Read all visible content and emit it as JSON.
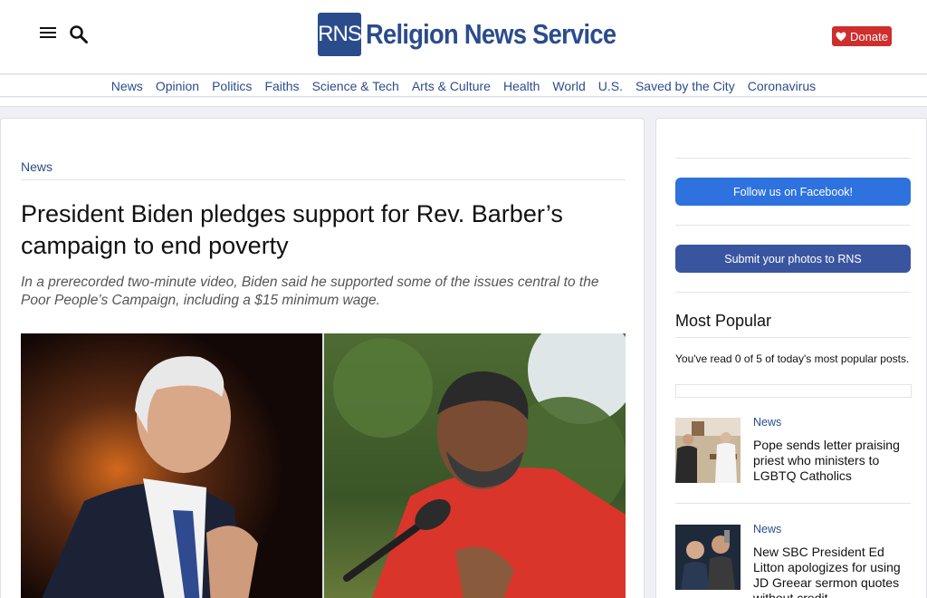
{
  "header": {
    "logo_mark": "RNS",
    "logo_text": "Religion News Service",
    "donate_label": "Donate",
    "brand_color": "#2b4c8c",
    "donate_color": "#cf2e2e"
  },
  "nav": {
    "items": [
      {
        "label": "News"
      },
      {
        "label": "Opinion"
      },
      {
        "label": "Politics"
      },
      {
        "label": "Faiths"
      },
      {
        "label": "Science & Tech"
      },
      {
        "label": "Arts & Culture"
      },
      {
        "label": "Health"
      },
      {
        "label": "World"
      },
      {
        "label": "U.S."
      },
      {
        "label": "Saved by the City"
      },
      {
        "label": "Coronavirus"
      }
    ]
  },
  "article": {
    "category": "News",
    "headline": "President Biden pledges support for Rev. Barber’s campaign to end poverty",
    "dek": "In a prerecorded two-minute video, Biden said he supported some of the issues central to the Poor People’s Campaign, including a $15 minimum wage."
  },
  "sidebar": {
    "facebook_button": "Follow us on Facebook!",
    "photos_button": "Submit your photos to RNS",
    "popular_title": "Most Popular",
    "popular_note": "You've read 0 of 5 of today's most popular posts.",
    "items": [
      {
        "category": "News",
        "title": "Pope sends letter praising priest who ministers to LGBTQ Catholics"
      },
      {
        "category": "News",
        "title": "New SBC President Ed Litton apologizes for using JD Greear sermon quotes without credit"
      }
    ]
  }
}
